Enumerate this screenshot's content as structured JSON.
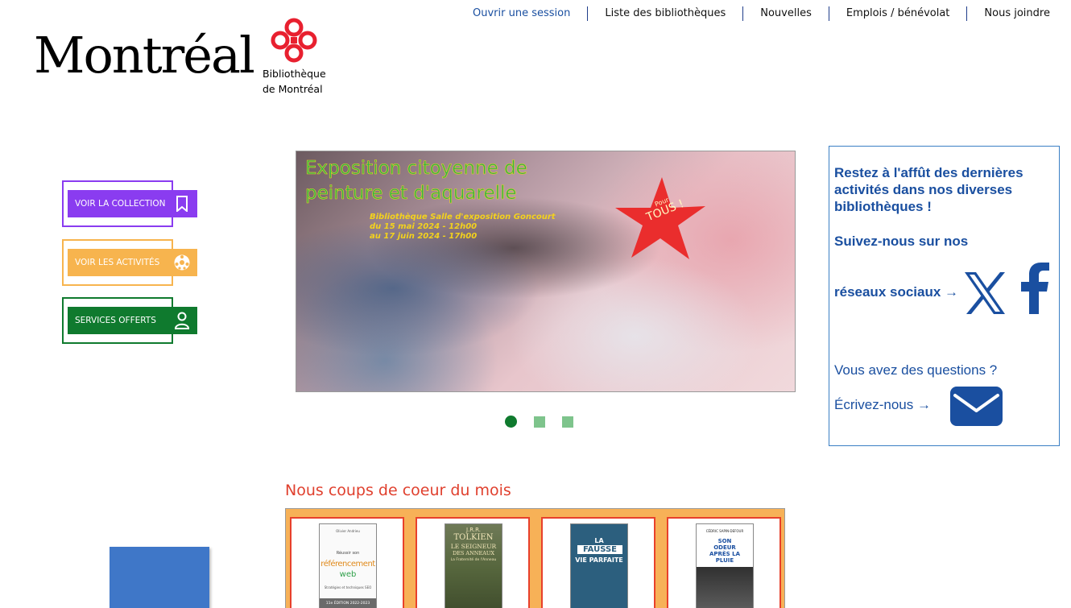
{
  "nav": {
    "login": "Ouvrir une session",
    "libraries": "Liste des bibliothèques",
    "news": "Nouvelles",
    "jobs": "Emplois / bénévolat",
    "contact": "Nous joindre"
  },
  "logo": {
    "wordmark": "Montréal",
    "sub_line1": "Bibliothèque",
    "sub_line2": "de Montréal",
    "mark_icon": "montreal-flower-logo"
  },
  "actions": [
    {
      "label": "VOIR LA COLLECTION",
      "icon": "bookmark-icon",
      "color": "#8a3cf0"
    },
    {
      "label": "VOIR LES ACTIVITÉS",
      "icon": "soccer-ball-icon",
      "color": "#f7b44e"
    },
    {
      "label": "SERVICES OFFERTS",
      "icon": "person-icon",
      "color": "#0f7a2e"
    }
  ],
  "carousel": {
    "title_line1": "Exposition citoyenne de",
    "title_line2": "peinture et d'aquarelle",
    "sub_line1": "Bibliothèque Salle d'exposition Goncourt",
    "sub_line2": "du 15 mai 2024 - 12h00",
    "sub_line3": "au 17 juin 2024 - 17h00",
    "star_small": "Pour",
    "star_big": "TOUS !",
    "slides": 3,
    "active_slide": 1
  },
  "sidebar": {
    "headline": "Restez à l'affût des dernières activités dans nos diverses bibliothèques !",
    "follow": "Suivez-nous sur nos",
    "social": "réseaux sociaux →",
    "questions": "Vous avez des questions ?",
    "write": "Écrivez-nous →",
    "colors": {
      "accent": "#1a4fa0",
      "border": "#3a7fc4"
    }
  },
  "picks": {
    "title": "Nous coups de coeur du mois",
    "books": [
      {
        "l1": "Olivier Andrieu",
        "l2": "Réussir son",
        "l3": "référencement",
        "l4": "web",
        "l5": "Stratégies et techniques SEO",
        "l6": "11e ÉDITION 2022-2023"
      },
      {
        "l1": "J.R.R.",
        "l2": "TOLKIEN",
        "l3": "LE SEIGNEUR",
        "l4": "DES ANNEAUX",
        "l5": "La Fraternité de l'Anneau"
      },
      {
        "l1": "LA",
        "l2": "FAUSSE",
        "l3": "VIE PARFAITE"
      },
      {
        "l1": "CÉDRIC SAPIN-DEFOUR",
        "l2": "SON",
        "l3": "ODEUR",
        "l4": "APRÈS LA",
        "l5": "PLUIE"
      }
    ]
  }
}
